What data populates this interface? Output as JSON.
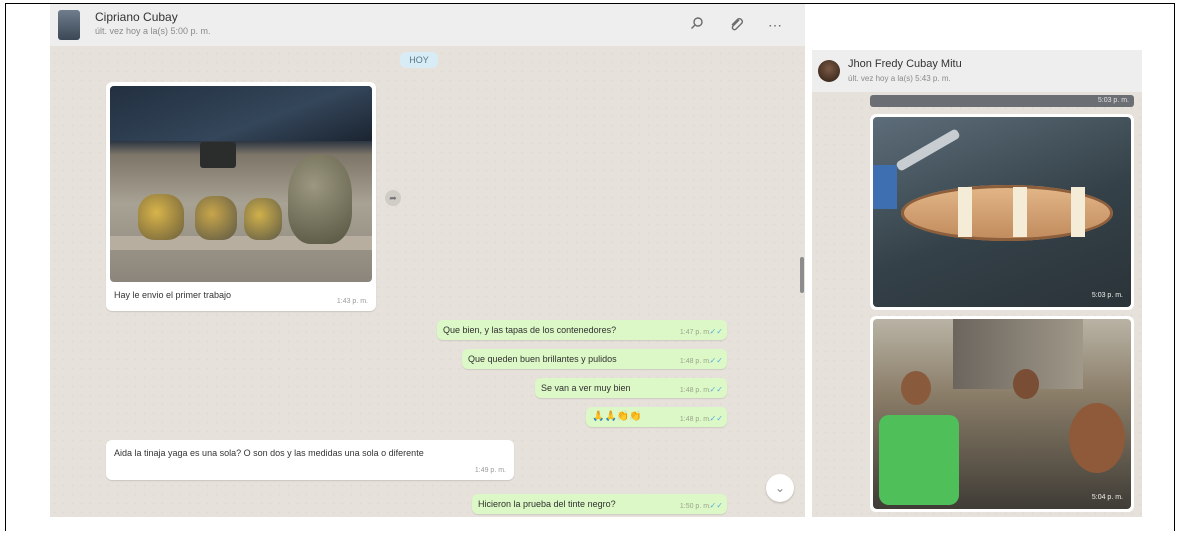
{
  "left_chat": {
    "contact_name": "Cipriano Cubay",
    "status": "últ. vez hoy a la(s) 5:00 p. m.",
    "date_chip": "HOY",
    "icons": [
      "search-icon",
      "paperclip-icon",
      "more-icon"
    ],
    "image_message": {
      "caption": "Hay le envio el primer trabajo",
      "time": "1:43 p. m."
    },
    "outgoing": [
      {
        "text": "Que bien, y las tapas de los contenedores?",
        "time": "1:47 p. m."
      },
      {
        "text": "Que queden buen brillantes y pulidos",
        "time": "1:48 p. m."
      },
      {
        "text": "Se van a ver muy bien",
        "time": "1:48 p. m."
      },
      {
        "text": "🙏🙏👏👏",
        "time": "1:48 p. m."
      }
    ],
    "incoming_long": {
      "text": "Aida la tinaja yaga es una sola? O son dos y las medidas una sola o diferente",
      "time": "1:49 p. m."
    },
    "last_outgoing": {
      "text": "Hicieron la prueba del tinte negro?",
      "time": "1:50 p. m."
    }
  },
  "right_chat": {
    "contact_name": "Jhon Fredy Cubay Mitu",
    "status": "últ. vez hoy a la(s) 5:43 p. m.",
    "top_strip_time": "5:03 p. m.",
    "canoe_time": "5:03 p. m.",
    "selfie_time": "5:04 p. m."
  },
  "colors": {
    "outgoing_bubble": "#dcf8c6",
    "chat_background": "#e6e1da",
    "header": "#eeeeee",
    "date_chip": "#d8ecf6"
  }
}
